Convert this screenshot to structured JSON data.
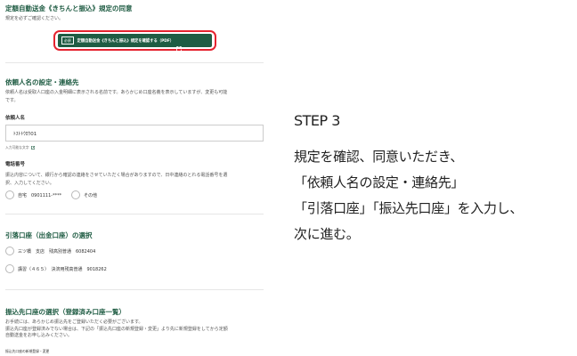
{
  "form": {
    "agreement": {
      "title": "定額自動送金《きちんと振込》規定の同意",
      "instruction": "規定を必ずご確認ください。",
      "pdf_button": {
        "tag": "必須",
        "label": "定額自動送金《きちんと振込》規定を確認する（PDF）",
        "icon": "external-link-icon"
      }
    },
    "requester": {
      "title": "依頼人名の設定・連絡先",
      "description_line1": "依頼人名は受取人口座の入金明細に表示される名前です。あらかじめ口座名義を表示していますが、変更も可能",
      "description_line2": "です。",
      "name_label": "依頼人名",
      "name_value": "ﾄｽﾄﾄｳﾛｳ01",
      "name_note": "入力可能な文字",
      "phone_label": "電話番号",
      "phone_desc_line1": "振込内容について、銀行から確認の連絡をさせていただく場合がありますので、日中連絡のとれる電話番号を選",
      "phone_desc_line2": "択、入力してください。",
      "phone_options": [
        "自宅　0901111-****",
        "その他"
      ]
    },
    "debit_account": {
      "title": "引落口座（出金口座）の選択",
      "options": [
        "三ツ橋　支店　残高別普通　6082404",
        "講習（４６５）　決済用残高普通　9018262"
      ]
    },
    "payee_account": {
      "title": "振込先口座の選択（登録済み口座一覧）",
      "desc_line1": "お手続には、あらかじめ振込先をご登録いただく必要がございます。",
      "desc_line2": "振込先口座が登録済みでない場合は、下記の「振込先口座の新規登録・変更」より先に新規登録をしてから定額",
      "desc_line3": "自動送金をお申し込みください。",
      "link": "振込先口座の新規登録・変更"
    }
  },
  "step": {
    "title": "STEP 3",
    "lines": [
      "規定を確認、同意いただき、",
      "「依頼人名の設定・連絡先」",
      "「引落口座」「振込先口座」を入力し、",
      "次に進む。"
    ]
  },
  "colors": {
    "brand_green": "#1f5c43",
    "highlight_red": "#e5232f"
  }
}
